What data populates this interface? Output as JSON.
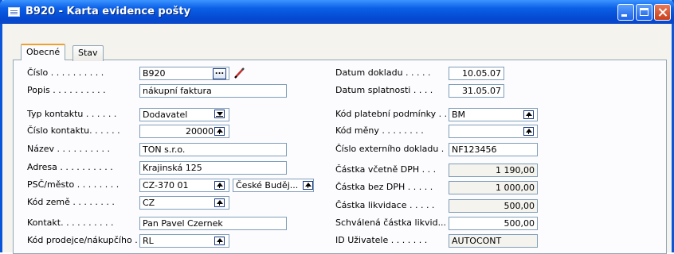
{
  "window": {
    "title": "B920 - Karta evidence pošty"
  },
  "tabs": [
    {
      "label": "Obecné",
      "active": true
    },
    {
      "label": "Stav",
      "active": false
    }
  ],
  "left": [
    {
      "label": "Číslo . . . . . . . . . .",
      "value": "B920"
    },
    {
      "label": "Popis . . . . . . . . . .",
      "value": "nákupní faktura"
    },
    {
      "label": "Typ kontaktu . . . . . .",
      "value": "Dodavatel"
    },
    {
      "label": "Číslo kontaktu. . . . . .",
      "value": "20000"
    },
    {
      "label": "Název . . . . . . . . . .",
      "value": "TON s.r.o."
    },
    {
      "label": "Adresa . . . . . . . . . .",
      "value": "Krajinská 125"
    },
    {
      "label": "PSČ/město . . . . . . . .",
      "value": "CZ-370 01",
      "value2": "České Buděj..."
    },
    {
      "label": "Kód země . . . . . . . .",
      "value": "CZ"
    },
    {
      "label": "Kontakt. . . . . . . . . .",
      "value": "Pan Pavel Czernek"
    },
    {
      "label": "Kód prodejce/nákupčího .",
      "value": "RL"
    }
  ],
  "right": [
    {
      "label": "Datum dokladu . . . . .",
      "value": "10.05.07"
    },
    {
      "label": "Datum splatnosti . . . .",
      "value": "31.05.07"
    },
    {
      "label": "Kód platební podmínky . .",
      "value": "BM"
    },
    {
      "label": "Kód měny . . . . . . . .",
      "value": ""
    },
    {
      "label": "Číslo externího dokladu .",
      "value": "NF123456"
    },
    {
      "label": "Částka včetně DPH . . .",
      "value": "1 190,00"
    },
    {
      "label": "Částka bez DPH . . . . .",
      "value": "1 000,00"
    },
    {
      "label": "Částka likvidace . . . . .",
      "value": "500,00"
    },
    {
      "label": "Schválená částka likvid...",
      "value": "500,00"
    },
    {
      "label": "ID Uživatele . . . . . . .",
      "value": "AUTOCONT"
    }
  ],
  "colors": {
    "titlebar": "#0a5fe6",
    "active_tab_accent": "#f0a030",
    "panel_bg": "#fcfcfe",
    "field_border": "#7f9db9"
  },
  "icons": [
    "window-app-icon",
    "minimize-icon",
    "maximize-icon",
    "close-icon",
    "ellipsis-icon",
    "pencil-icon",
    "dropdown-arrow-icon",
    "lookup-arrow-icon"
  ]
}
